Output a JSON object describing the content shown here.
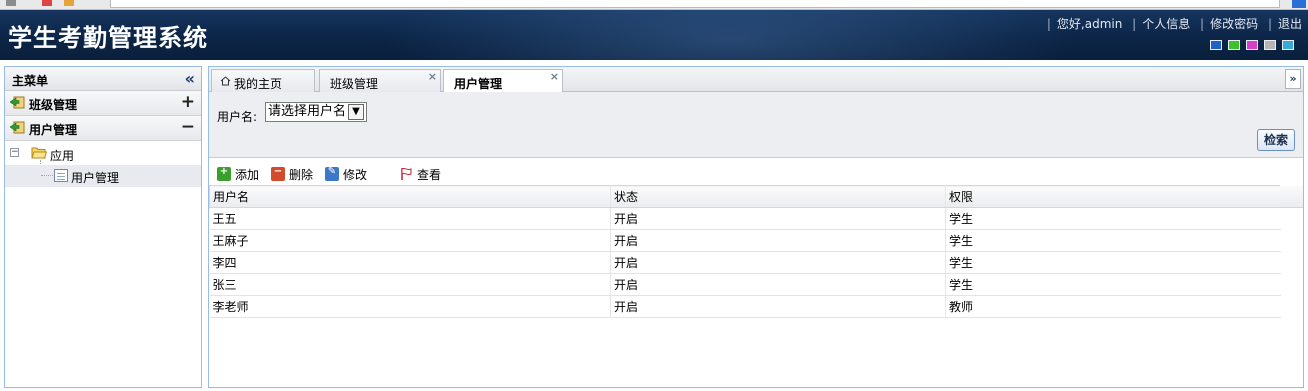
{
  "header": {
    "app_title": "学生考勤管理系统",
    "links": [
      "您好,admin",
      "个人信息",
      "修改密码",
      "退出"
    ],
    "theme_colors": [
      "#1e62c8",
      "#3ec22b",
      "#d640c8",
      "#b5b5b5",
      "#39a9d8"
    ]
  },
  "sidebar": {
    "title": "主菜单",
    "collapse_icon": "double-chevron-left-icon",
    "sections": [
      {
        "label": "班级管理",
        "toggle": "+"
      },
      {
        "label": "用户管理",
        "toggle": "−"
      }
    ],
    "tree": {
      "root_expander": "−",
      "root_label": "应用",
      "child_label": "用户管理"
    }
  },
  "tabs": [
    {
      "label": "我的主页",
      "closable": false
    },
    {
      "label": "班级管理",
      "closable": true
    },
    {
      "label": "用户管理",
      "closable": true,
      "active": true
    }
  ],
  "tab_close_glyph": "×",
  "tab_menu_glyph": "»",
  "search": {
    "username_label": "用户名:",
    "username_select": "请选择用户名",
    "select_arrow": "▼",
    "search_button": "检索"
  },
  "toolbar": {
    "add": "添加",
    "delete": "删除",
    "edit": "修改",
    "view": "查看"
  },
  "grid": {
    "columns": [
      "用户名",
      "状态",
      "权限"
    ],
    "rows": [
      [
        "王五",
        "开启",
        "学生"
      ],
      [
        "王麻子",
        "开启",
        "学生"
      ],
      [
        "李四",
        "开启",
        "学生"
      ],
      [
        "张三",
        "开启",
        "学生"
      ],
      [
        "李老师",
        "开启",
        "教师"
      ]
    ]
  }
}
